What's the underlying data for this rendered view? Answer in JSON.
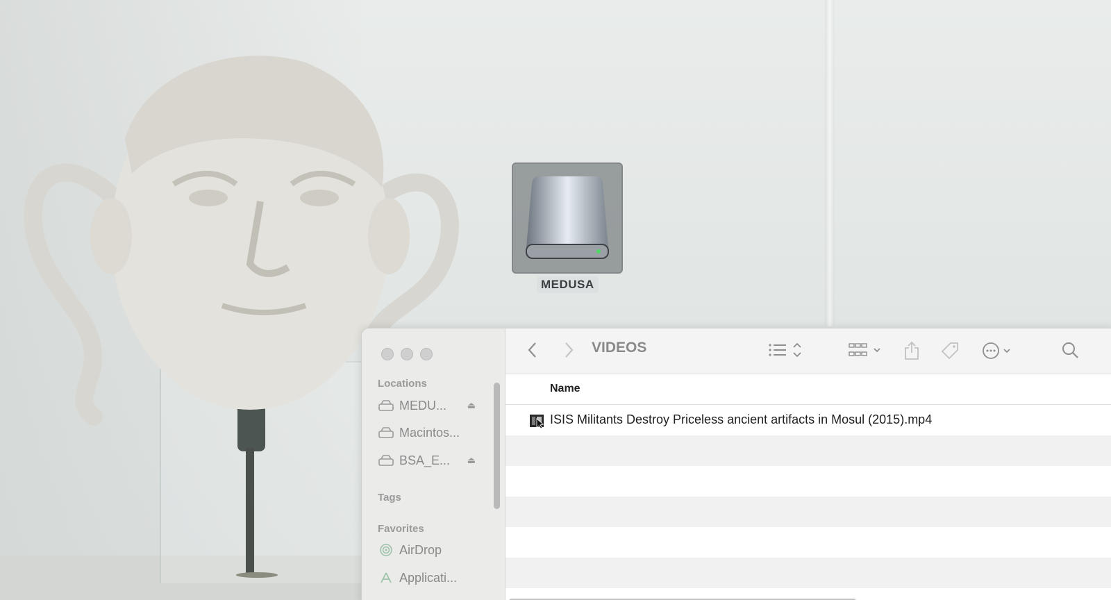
{
  "desktop": {
    "drive_label": "MEDUSA"
  },
  "finder": {
    "title": "VIDEOS",
    "sidebar": {
      "locations_header": "Locations",
      "locations": [
        {
          "label": "MEDU...",
          "icon": "drive-icon",
          "ejectable": true
        },
        {
          "label": "Macintos...",
          "icon": "drive-icon",
          "ejectable": false
        },
        {
          "label": "BSA_E...",
          "icon": "drive-icon",
          "ejectable": true
        }
      ],
      "tags_header": "Tags",
      "favorites_header": "Favorites",
      "favorites": [
        {
          "label": "AirDrop",
          "icon": "airdrop-icon"
        },
        {
          "label": "Applicati...",
          "icon": "applications-icon"
        }
      ]
    },
    "list": {
      "column_name": "Name",
      "files": [
        {
          "name": "ISIS Militants Destroy Priceless ancient artifacts in Mosul (2015).mp4",
          "icon": "video-file-icon"
        }
      ]
    }
  }
}
